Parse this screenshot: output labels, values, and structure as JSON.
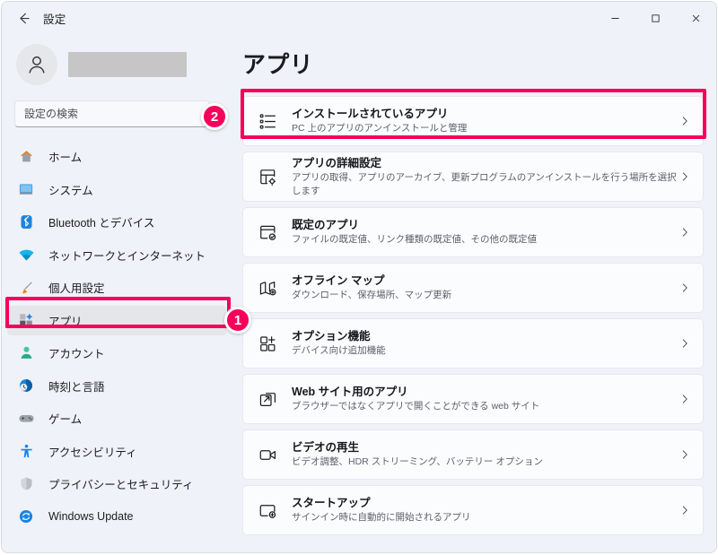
{
  "window": {
    "title": "設定",
    "back_icon": "back-arrow-icon",
    "controls": {
      "minimize": "minimize-icon",
      "maximize": "maximize-icon",
      "close": "close-icon"
    }
  },
  "sidebar": {
    "account": {
      "avatar_icon": "person-avatar-icon",
      "name": ""
    },
    "search": {
      "placeholder": "設定の検索",
      "value": ""
    },
    "items": [
      {
        "label": "ホーム",
        "icon": "home-icon",
        "selected": false
      },
      {
        "label": "システム",
        "icon": "monitor-icon",
        "selected": false
      },
      {
        "label": "Bluetooth とデバイス",
        "icon": "bluetooth-icon",
        "selected": false
      },
      {
        "label": "ネットワークとインターネット",
        "icon": "wifi-icon",
        "selected": false
      },
      {
        "label": "個人用設定",
        "icon": "paintbrush-icon",
        "selected": false
      },
      {
        "label": "アプリ",
        "icon": "apps-icon",
        "selected": true
      },
      {
        "label": "アカウント",
        "icon": "account-person-icon",
        "selected": false
      },
      {
        "label": "時刻と言語",
        "icon": "clock-globe-icon",
        "selected": false
      },
      {
        "label": "ゲーム",
        "icon": "gamepad-icon",
        "selected": false
      },
      {
        "label": "アクセシビリティ",
        "icon": "accessibility-icon",
        "selected": false
      },
      {
        "label": "プライバシーとセキュリティ",
        "icon": "shield-icon",
        "selected": false
      },
      {
        "label": "Windows Update",
        "icon": "update-refresh-icon",
        "selected": false
      }
    ]
  },
  "main": {
    "page_title": "アプリ",
    "cards": [
      {
        "title": "インストールされているアプリ",
        "subtitle": "PC 上のアプリのアンインストールと管理",
        "icon": "installed-apps-list-icon",
        "chevron": "chevron-right-icon",
        "highlighted": true
      },
      {
        "title": "アプリの詳細設定",
        "subtitle": "アプリの取得、アプリのアーカイブ、更新プログラムのアンインストールを行う場所を選択します",
        "icon": "app-settings-gear-icon",
        "chevron": "chevron-right-icon",
        "highlighted": false
      },
      {
        "title": "既定のアプリ",
        "subtitle": "ファイルの既定値、リンク種類の既定値、その他の既定値",
        "icon": "default-apps-check-icon",
        "chevron": "chevron-right-icon",
        "highlighted": false
      },
      {
        "title": "オフライン マップ",
        "subtitle": "ダウンロード、保存場所、マップ更新",
        "icon": "offline-map-icon",
        "chevron": "chevron-right-icon",
        "highlighted": false
      },
      {
        "title": "オプション機能",
        "subtitle": "デバイス向け追加機能",
        "icon": "optional-features-grid-plus-icon",
        "chevron": "chevron-right-icon",
        "highlighted": false
      },
      {
        "title": "Web サイト用のアプリ",
        "subtitle": "ブラウザーではなくアプリで開くことができる web サイト",
        "icon": "website-apps-external-link-icon",
        "chevron": "chevron-right-icon",
        "highlighted": false
      },
      {
        "title": "ビデオの再生",
        "subtitle": "ビデオ調整、HDR ストリーミング、バッテリー オプション",
        "icon": "video-playback-camera-icon",
        "chevron": "chevron-right-icon",
        "highlighted": false
      },
      {
        "title": "スタートアップ",
        "subtitle": "サインイン時に自動的に開始されるアプリ",
        "icon": "startup-apps-icon",
        "chevron": "chevron-right-icon",
        "highlighted": false
      }
    ]
  },
  "annotations": {
    "accent_color": "#f5005a",
    "steps": [
      {
        "number": "1",
        "target": "sidebar-item-apps"
      },
      {
        "number": "2",
        "target": "card-installed-apps"
      }
    ]
  }
}
